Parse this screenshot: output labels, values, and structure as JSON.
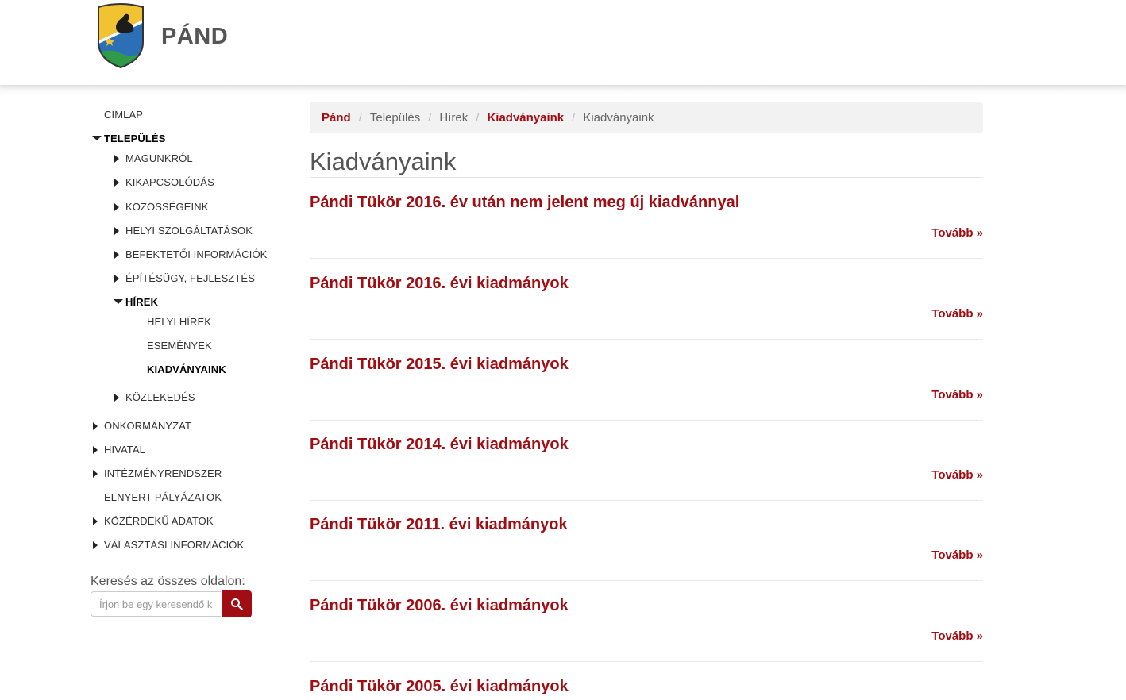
{
  "site": {
    "title": "PÁND"
  },
  "sidebar": {
    "items": [
      {
        "label": "CÍMLAP"
      },
      {
        "label": "TELEPÜLÉS"
      },
      {
        "label": "MAGUNKRÓL"
      },
      {
        "label": "KIKAPCSOLÓDÁS"
      },
      {
        "label": "KÖZÖSSÉGEINK"
      },
      {
        "label": "HELYI SZOLGÁLTATÁSOK"
      },
      {
        "label": "BEFEKTETŐI INFORMÁCIÓK"
      },
      {
        "label": "ÉPÍTÉSÜGY, FEJLESZTÉS"
      },
      {
        "label": "HÍREK"
      },
      {
        "label": "HELYI HÍREK"
      },
      {
        "label": "ESEMÉNYEK"
      },
      {
        "label": "KIADVÁNYAINK"
      },
      {
        "label": "KÖZLEKEDÉS"
      },
      {
        "label": "ÖNKORMÁNYZAT"
      },
      {
        "label": "HIVATAL"
      },
      {
        "label": "INTÉZMÉNYRENDSZER"
      },
      {
        "label": "ELNYERT PÁLYÁZATOK"
      },
      {
        "label": "KÖZÉRDEKŰ ADATOK"
      },
      {
        "label": "VÁLASZTÁSI INFORMÁCIÓK"
      }
    ]
  },
  "search": {
    "label": "Keresés az összes oldalon:",
    "placeholder": "Írjon be egy keresendő kifejezést"
  },
  "breadcrumb": [
    {
      "label": "Pánd"
    },
    {
      "label": "Település"
    },
    {
      "label": "Hírek"
    },
    {
      "label": "Kiadványaink"
    },
    {
      "label": "Kiadványaink"
    }
  ],
  "main": {
    "title": "Kiadványaink",
    "articles": [
      {
        "title": "Pándi Tükör 2016. év után nem jelent meg új kiadvánnyal",
        "more": "Tovább »"
      },
      {
        "title": "Pándi Tükör 2016. évi kiadmányok",
        "more": "Tovább »"
      },
      {
        "title": "Pándi Tükör 2015. évi kiadmányok",
        "more": "Tovább »"
      },
      {
        "title": "Pándi Tükör 2014. évi kiadmányok",
        "more": "Tovább »"
      },
      {
        "title": "Pándi Tükör 2011. évi kiadmányok",
        "more": "Tovább »"
      },
      {
        "title": "Pándi Tükör 2006. évi kiadmányok",
        "more": "Tovább »"
      },
      {
        "title": "Pándi Tükör 2005. évi kiadmányok",
        "more": "Tovább »"
      }
    ]
  },
  "colors": {
    "accent": "#a00d12",
    "breadcrumb_bg": "#f2f2f2"
  },
  "icons": {
    "search": "search-icon",
    "logo": "coat-of-arms"
  }
}
